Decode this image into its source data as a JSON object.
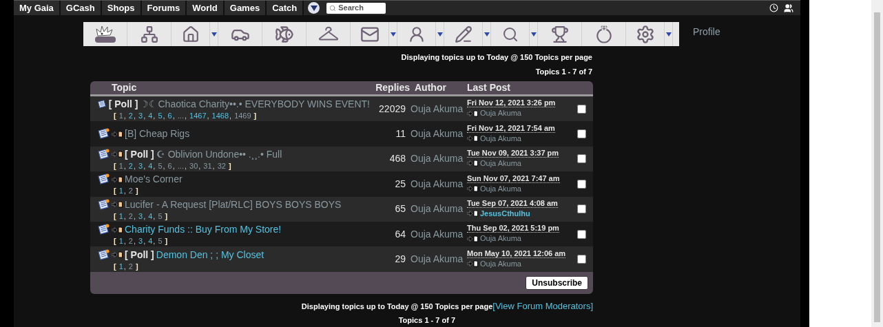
{
  "top_nav": {
    "tabs": [
      {
        "label": "My Gaia"
      },
      {
        "label": "GCash"
      },
      {
        "label": "Shops"
      },
      {
        "label": "Forums"
      },
      {
        "label": "World"
      },
      {
        "label": "Games"
      },
      {
        "label": "Catch"
      }
    ],
    "search": {
      "placeholder": "Search"
    }
  },
  "toolbar": {
    "items": [
      {
        "kind": "gaia",
        "dropdown": false
      },
      {
        "kind": "network",
        "dropdown": false
      },
      {
        "kind": "house",
        "dropdown": true
      },
      {
        "kind": "car",
        "dropdown": false
      },
      {
        "kind": "fish",
        "dropdown": false
      },
      {
        "kind": "hanger",
        "dropdown": false
      },
      {
        "kind": "mail",
        "dropdown": true
      },
      {
        "kind": "people",
        "dropdown": true
      },
      {
        "kind": "pencil",
        "dropdown": true
      },
      {
        "kind": "search",
        "dropdown": true
      },
      {
        "kind": "trophy",
        "dropdown": false
      },
      {
        "kind": "ring",
        "dropdown": false
      },
      {
        "kind": "gear",
        "dropdown": true
      }
    ],
    "profile_link": "Profile"
  },
  "info_top": {
    "display": "Displaying topics up to Today @ 150 Topics per page",
    "count": "Topics 1 - 7 of 7"
  },
  "table": {
    "columns": [
      "Topic",
      "Replies",
      "Author",
      "Last Post"
    ],
    "rows": [
      {
        "new_arrow": false,
        "prefix": "[ Poll ]",
        "title": "☽☾Chaotica Charity••.• EVERYBODY WINS EVENT!",
        "unread": false,
        "pager": {
          "open": "[",
          "close": "]",
          "separator": ",",
          "pages": [
            {
              "label": "1",
              "visited": true
            },
            {
              "label": "2",
              "visited": false
            },
            {
              "label": "3",
              "visited": false
            },
            {
              "label": "4",
              "visited": false
            },
            {
              "label": "5",
              "visited": false
            },
            {
              "label": "6",
              "visited": false
            },
            {
              "label": "...",
              "visited": true
            },
            {
              "label": "1467",
              "visited": false
            },
            {
              "label": "1468",
              "visited": false
            },
            {
              "label": "1469",
              "visited": true
            }
          ]
        },
        "replies": "22029",
        "author": "Ouja Akuma",
        "last_post": "Fri Nov 12, 2021 3:26 pm",
        "last_author": "Ouja Akuma",
        "last_author_unread": false,
        "checked": false
      },
      {
        "new_arrow": true,
        "title": "[B] Cheap Rigs",
        "unread": false,
        "replies": "11",
        "author": "Ouja Akuma",
        "last_post": "Fri Nov 12, 2021 7:54 am",
        "last_author": "Ouja Akuma",
        "last_author_unread": false,
        "checked": false
      },
      {
        "new_arrow": true,
        "prefix": "[ Poll ]",
        "title": "☪ Oblivion Undone•• .¸¸.• Full",
        "unread": false,
        "pager": {
          "open": "[",
          "close": "]",
          "separator": ",",
          "pages": [
            {
              "label": "1",
              "visited": true
            },
            {
              "label": "2",
              "visited": false
            },
            {
              "label": "3",
              "visited": false
            },
            {
              "label": "4",
              "visited": false
            },
            {
              "label": "5",
              "visited": true
            },
            {
              "label": "6",
              "visited": true
            },
            {
              "label": "...",
              "visited": true
            },
            {
              "label": "30",
              "visited": true
            },
            {
              "label": "31",
              "visited": true
            },
            {
              "label": "32",
              "visited": true
            }
          ]
        },
        "replies": "468",
        "author": "Ouja Akuma",
        "last_post": "Tue Nov 09, 2021 3:37 pm",
        "last_author": "Ouja Akuma",
        "last_author_unread": false,
        "checked": false
      },
      {
        "new_arrow": true,
        "title": "Moe's Corner",
        "unread": false,
        "pager": {
          "open": "[",
          "close": "]",
          "separator": ",",
          "pages": [
            {
              "label": "1",
              "visited": false
            },
            {
              "label": "2",
              "visited": true
            }
          ]
        },
        "replies": "25",
        "author": "Ouja Akuma",
        "last_post": "Sun Nov 07, 2021 7:47 am",
        "last_author": "Ouja Akuma",
        "last_author_unread": false,
        "checked": false
      },
      {
        "new_arrow": true,
        "title": "Lucifer - A Request [Plat/RLC] BOYS BOYS BOYS",
        "unread": false,
        "pager": {
          "open": "[",
          "close": "]",
          "separator": ",",
          "pages": [
            {
              "label": "1",
              "visited": false
            },
            {
              "label": "2",
              "visited": true
            },
            {
              "label": "3",
              "visited": false
            },
            {
              "label": "4",
              "visited": false
            },
            {
              "label": "5",
              "visited": true
            }
          ]
        },
        "replies": "65",
        "author": "Ouja Akuma",
        "last_post": "Tue Sep 07, 2021 4:08 am",
        "last_author": "JesusCthulhu",
        "last_author_unread": true,
        "checked": false
      },
      {
        "new_arrow": true,
        "title": "Charity Funds :: Buy From My Store!",
        "unread": true,
        "pager": {
          "open": "[",
          "close": "]",
          "separator": ",",
          "pages": [
            {
              "label": "1",
              "visited": false
            },
            {
              "label": "2",
              "visited": true
            },
            {
              "label": "3",
              "visited": false
            },
            {
              "label": "4",
              "visited": false
            },
            {
              "label": "5",
              "visited": true
            }
          ]
        },
        "replies": "64",
        "author": "Ouja Akuma",
        "last_post": "Thu Sep 02, 2021 5:19 pm",
        "last_author": "Ouja Akuma",
        "last_author_unread": false,
        "checked": false
      },
      {
        "new_arrow": true,
        "prefix": "[ Poll ]",
        "title": "Demon Den ; ; My Closet",
        "unread": true,
        "pager": {
          "open": "[",
          "close": "]",
          "separator": ",",
          "pages": [
            {
              "label": "1",
              "visited": false
            },
            {
              "label": "2",
              "visited": true
            }
          ]
        },
        "replies": "29",
        "author": "Ouja Akuma",
        "last_post": "Mon May 10, 2021 12:06 am",
        "last_author": "Ouja Akuma",
        "last_author_unread": false,
        "checked": false
      }
    ],
    "footer_button": "Unsubscribe"
  },
  "info_bottom": {
    "display": "Displaying topics up to Today @ 150 Topics per page",
    "moderators_link": "[View Forum Moderators]",
    "count": "Topics 1 - 7 of 7"
  }
}
